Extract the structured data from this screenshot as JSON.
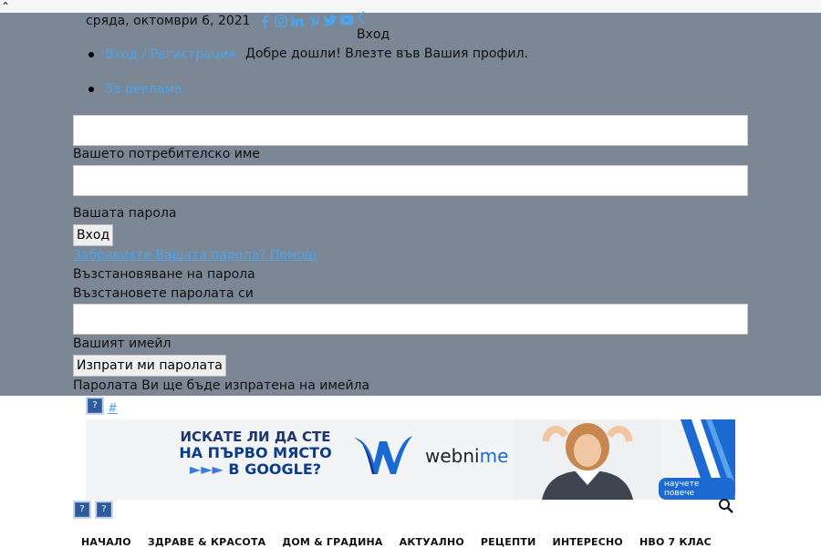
{
  "header": {
    "date": "сряда, октомври 6, 2021",
    "social_icons": [
      "facebook-icon",
      "instagram-icon",
      "linkedin-icon",
      "pinterest-icon",
      "twitter-icon",
      "youtube-icon"
    ]
  },
  "login_panel": {
    "heading": "Вход",
    "welcome": "Добре дошли! Влезте във Вашия профил.",
    "menu": [
      {
        "label": "Вход / Регистрация"
      },
      {
        "label": "За реклама"
      }
    ],
    "username_label": "Вашето потребителско име",
    "password_label": "Вашата парола",
    "login_button": "Вход",
    "forgot_link": "Забравихте Вашата парола? Помощ",
    "recover_title": "Възстановяване на парола",
    "recover_subtitle": "Възстановете паролата си",
    "email_label": "Вашият имейл",
    "send_button": "Изпрати ми паролата",
    "send_note": "Паролата Ви ще бъде изпратена на имейла"
  },
  "misc": {
    "hash_link": "#",
    "broken_image_glyph": "?"
  },
  "banner": {
    "line1": "ИСКАТЕ ЛИ ДА СТЕ",
    "line2": "НА ПЪРВО МЯСТО",
    "line3_arrows": "►►►",
    "line3_text": "В GOOGLE?",
    "brand_main": "webni",
    "brand_accent": "me",
    "cta": "научете повече",
    "accent_color": "#1b6ad1"
  },
  "nav": {
    "items": [
      "НАЧАЛО",
      "ЗДРАВЕ & КРАСОТА",
      "ДОМ & ГРАДИНА",
      "АКТУАЛНО",
      "РЕЦЕПТИ",
      "ИНТЕРЕСНО",
      "НВО 7 КЛАС"
    ]
  },
  "colors": {
    "overlay": "#7b8794",
    "link": "#4fa3e6"
  }
}
